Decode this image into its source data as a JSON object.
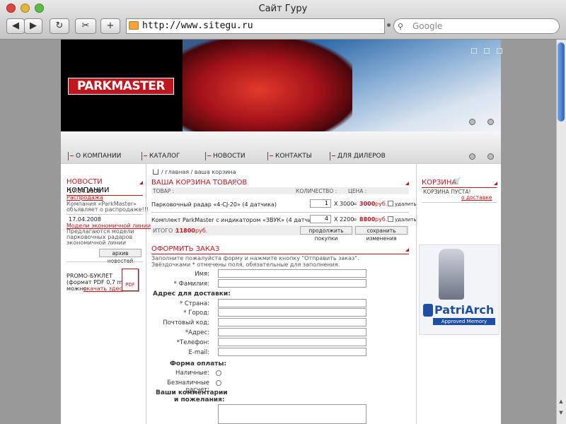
{
  "window": {
    "title": "Сайт Гуру"
  },
  "toolbar": {
    "back": "◀",
    "forward": "▶",
    "reload": "↻",
    "add": "+",
    "url": "http://www.sitegu.ru",
    "search_placeholder": "Google"
  },
  "brand": {
    "logo": "PARKMASTER"
  },
  "menu": [
    "О КОМПАНИИ",
    "КАТАЛОГ",
    "НОВОСТИ",
    "КОНТАКТЫ",
    "ДЛЯ ДИЛЕРОВ"
  ],
  "news": {
    "heading_red": "НОВОСТИ",
    "heading_black": "КОМПАНИИ",
    "items": [
      {
        "date": "17.04.2008",
        "title": "Распродажа",
        "text1": "Компания «ParkMaster»",
        "text2": "объявляет о распродаже!!!"
      },
      {
        "date": "17.04.2008",
        "title": "Модели экономичной линии",
        "text1": "Предлагаются модели",
        "text2": "парковочных радаров",
        "text3": "экономичной линии"
      }
    ],
    "archive": "архив новостей"
  },
  "promo": {
    "line1": "PROMO-БУКЛЕТ",
    "line2": "(формат PDF 0,7 mb)",
    "line3": "можно",
    "link": "скачать здесь",
    "pdf": "PDF"
  },
  "breadcrumb": "/ главная / ваша корзина",
  "cart": {
    "heading": "ВАША КОРЗИНА ТОВАРОВ",
    "col_product": "ТОВАР :",
    "col_qty": "КОЛИЧЕСТВО :",
    "col_price": "ЦЕНА :",
    "rows": [
      {
        "name": "Парковочный радар «4-CJ-20» (4 датчика)",
        "qty": "1",
        "unit": "X 3000",
        "eq": "=",
        "total": "3000",
        "cur": "руб.",
        "del": "удалить"
      },
      {
        "name": "Комплект ParkMaster с индикатором «ЗВУК» (4 датчика)",
        "qty": "4",
        "unit": "X 2200",
        "eq": "=",
        "total": "8800",
        "cur": "руб.",
        "del": "удалить"
      }
    ],
    "total_label": "ИТОГО :",
    "total_value": "11800",
    "total_cur": "руб.",
    "continue": "продолжить покупки",
    "save": "сохранить изменения"
  },
  "order": {
    "heading": "ОФОРМИТЬ ЗАКАЗ",
    "intro1": "Заполните пожалуйста форму и нажмите кнопку \"Отправить заказ\".",
    "intro2": "Звёздочками * отмечены поля, обязательные для заполнения.",
    "name": "Имя:",
    "surname": "* Фамилия:",
    "address_head": "Адрес для доставки:",
    "country": "* Страна:",
    "city": "* Город:",
    "zip": "Почтовый код:",
    "address": "*Адрес:",
    "phone": "*Телефон:",
    "email": "E-mail:",
    "payment_head": "Форма оплаты:",
    "cash": "Наличные:",
    "cashless": "Безналичные расчет:",
    "comments1": "Ваши комментарии",
    "comments2": "и пожелания:"
  },
  "basket": {
    "heading": "КОРЗИНА",
    "empty": "КОРЗИНА ПУСТА!",
    "link": "о доставке"
  },
  "ad": {
    "brand": "PatriArch",
    "tagline": "Approved Memory"
  },
  "colors": {
    "accent": "#c3161c",
    "logo_bg": "#c3161c"
  }
}
